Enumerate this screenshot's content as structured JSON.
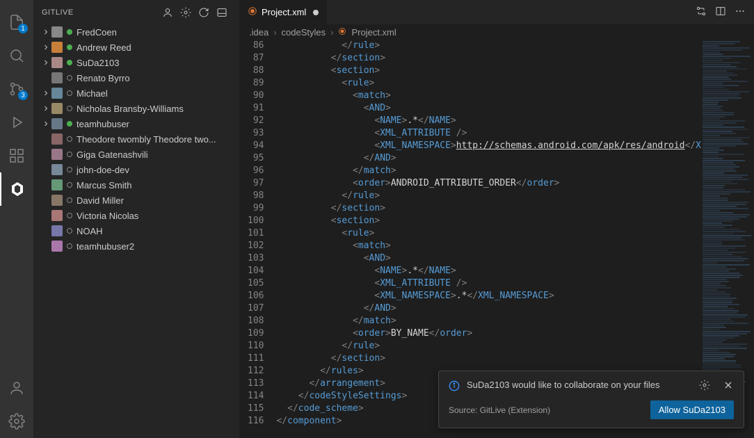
{
  "sidebar": {
    "title": "GITLIVE",
    "users": [
      {
        "name": "FredCoen",
        "status": "online",
        "expandable": true,
        "avatarColor": "#888"
      },
      {
        "name": "Andrew Reed",
        "status": "online",
        "expandable": true,
        "avatarColor": "#c87f3a"
      },
      {
        "name": "SuDa2103",
        "status": "online",
        "expandable": true,
        "avatarColor": "#a88"
      },
      {
        "name": "Renato Byrro",
        "status": "offline",
        "expandable": false,
        "avatarColor": "#777"
      },
      {
        "name": "Michael",
        "status": "offline",
        "expandable": true,
        "avatarColor": "#689"
      },
      {
        "name": "Nicholas Bransby-Williams",
        "status": "offline",
        "expandable": true,
        "avatarColor": "#986"
      },
      {
        "name": "teamhubuser",
        "status": "online",
        "expandable": true,
        "avatarColor": "#678"
      },
      {
        "name": "Theodore twombly Theodore two...",
        "status": "offline",
        "expandable": false,
        "avatarColor": "#866"
      },
      {
        "name": "Giga Gatenashvili",
        "status": "offline",
        "expandable": false,
        "avatarColor": "#978"
      },
      {
        "name": "john-doe-dev",
        "status": "offline",
        "expandable": false,
        "avatarColor": "#789"
      },
      {
        "name": "Marcus Smith",
        "status": "offline",
        "expandable": false,
        "avatarColor": "#697"
      },
      {
        "name": "David Miller",
        "status": "offline",
        "expandable": false,
        "avatarColor": "#876"
      },
      {
        "name": "Victoria Nicolas",
        "status": "offline",
        "expandable": false,
        "avatarColor": "#a77"
      },
      {
        "name": "NOAH",
        "status": "offline",
        "expandable": false,
        "avatarColor": "#77a"
      },
      {
        "name": "teamhubuser2",
        "status": "offline",
        "expandable": false,
        "avatarColor": "#a7a"
      }
    ]
  },
  "activityBadges": {
    "explorer": "1",
    "scm": "3"
  },
  "tab": {
    "label": "Project.xml"
  },
  "breadcrumb": {
    "seg1": ".idea",
    "seg2": "codeStyles",
    "seg3": "Project.xml"
  },
  "code": {
    "startLine": 86,
    "lines": [
      {
        "indent": 6,
        "html": "<span class='t-bracket'>&lt;/</span><span class='t-tag'>rule</span><span class='t-bracket'>&gt;</span>"
      },
      {
        "indent": 5,
        "html": "<span class='t-bracket'>&lt;/</span><span class='t-tag'>section</span><span class='t-bracket'>&gt;</span>"
      },
      {
        "indent": 5,
        "html": "<span class='t-bracket'>&lt;</span><span class='t-tag'>section</span><span class='t-bracket'>&gt;</span>"
      },
      {
        "indent": 6,
        "html": "<span class='t-bracket'>&lt;</span><span class='t-tag'>rule</span><span class='t-bracket'>&gt;</span>"
      },
      {
        "indent": 7,
        "html": "<span class='t-bracket'>&lt;</span><span class='t-tag'>match</span><span class='t-bracket'>&gt;</span>"
      },
      {
        "indent": 8,
        "html": "<span class='t-bracket'>&lt;</span><span class='t-tag'>AND</span><span class='t-bracket'>&gt;</span>"
      },
      {
        "indent": 9,
        "html": "<span class='t-bracket'>&lt;</span><span class='t-tag'>NAME</span><span class='t-bracket'>&gt;</span><span class='t-text'>.*</span><span class='t-bracket'>&lt;/</span><span class='t-tag'>NAME</span><span class='t-bracket'>&gt;</span>"
      },
      {
        "indent": 9,
        "html": "<span class='t-bracket'>&lt;</span><span class='t-tag'>XML_ATTRIBUTE</span><span class='t-bracket'> /&gt;</span>"
      },
      {
        "indent": 9,
        "html": "<span class='t-bracket'>&lt;</span><span class='t-tag'>XML_NAMESPACE</span><span class='t-bracket'>&gt;</span><span class='t-url'>http://schemas.android.com/apk/res/android</span><span class='t-bracket'>&lt;/</span><span class='t-tag'>X</span>"
      },
      {
        "indent": 8,
        "html": "<span class='t-bracket'>&lt;/</span><span class='t-tag'>AND</span><span class='t-bracket'>&gt;</span>"
      },
      {
        "indent": 7,
        "html": "<span class='t-bracket'>&lt;/</span><span class='t-tag'>match</span><span class='t-bracket'>&gt;</span>"
      },
      {
        "indent": 7,
        "html": "<span class='t-bracket'>&lt;</span><span class='t-tag'>order</span><span class='t-bracket'>&gt;</span><span class='t-text'>ANDROID_ATTRIBUTE_ORDER</span><span class='t-bracket'>&lt;/</span><span class='t-tag'>order</span><span class='t-bracket'>&gt;</span>"
      },
      {
        "indent": 6,
        "html": "<span class='t-bracket'>&lt;/</span><span class='t-tag'>rule</span><span class='t-bracket'>&gt;</span>"
      },
      {
        "indent": 5,
        "html": "<span class='t-bracket'>&lt;/</span><span class='t-tag'>section</span><span class='t-bracket'>&gt;</span>"
      },
      {
        "indent": 5,
        "html": "<span class='t-bracket'>&lt;</span><span class='t-tag'>section</span><span class='t-bracket'>&gt;</span>"
      },
      {
        "indent": 6,
        "html": "<span class='t-bracket'>&lt;</span><span class='t-tag'>rule</span><span class='t-bracket'>&gt;</span>"
      },
      {
        "indent": 7,
        "html": "<span class='t-bracket'>&lt;</span><span class='t-tag'>match</span><span class='t-bracket'>&gt;</span>"
      },
      {
        "indent": 8,
        "html": "<span class='t-bracket'>&lt;</span><span class='t-tag'>AND</span><span class='t-bracket'>&gt;</span>"
      },
      {
        "indent": 9,
        "html": "<span class='t-bracket'>&lt;</span><span class='t-tag'>NAME</span><span class='t-bracket'>&gt;</span><span class='t-text'>.*</span><span class='t-bracket'>&lt;/</span><span class='t-tag'>NAME</span><span class='t-bracket'>&gt;</span>"
      },
      {
        "indent": 9,
        "html": "<span class='t-bracket'>&lt;</span><span class='t-tag'>XML_ATTRIBUTE</span><span class='t-bracket'> /&gt;</span>"
      },
      {
        "indent": 9,
        "html": "<span class='t-bracket'>&lt;</span><span class='t-tag'>XML_NAMESPACE</span><span class='t-bracket'>&gt;</span><span class='t-text'>.*</span><span class='t-bracket'>&lt;/</span><span class='t-tag'>XML_NAMESPACE</span><span class='t-bracket'>&gt;</span>"
      },
      {
        "indent": 8,
        "html": "<span class='t-bracket'>&lt;/</span><span class='t-tag'>AND</span><span class='t-bracket'>&gt;</span>"
      },
      {
        "indent": 7,
        "html": "<span class='t-bracket'>&lt;/</span><span class='t-tag'>match</span><span class='t-bracket'>&gt;</span>"
      },
      {
        "indent": 7,
        "html": "<span class='t-bracket'>&lt;</span><span class='t-tag'>order</span><span class='t-bracket'>&gt;</span><span class='t-text'>BY_NAME</span><span class='t-bracket'>&lt;/</span><span class='t-tag'>order</span><span class='t-bracket'>&gt;</span>"
      },
      {
        "indent": 6,
        "html": "<span class='t-bracket'>&lt;/</span><span class='t-tag'>rule</span><span class='t-bracket'>&gt;</span>"
      },
      {
        "indent": 5,
        "html": "<span class='t-bracket'>&lt;/</span><span class='t-tag'>section</span><span class='t-bracket'>&gt;</span>"
      },
      {
        "indent": 4,
        "html": "<span class='t-bracket'>&lt;/</span><span class='t-tag'>rules</span><span class='t-bracket'>&gt;</span>"
      },
      {
        "indent": 3,
        "html": "<span class='t-bracket'>&lt;/</span><span class='t-tag'>arrangement</span><span class='t-bracket'>&gt;</span>"
      },
      {
        "indent": 2,
        "html": "<span class='t-bracket'>&lt;/</span><span class='t-tag'>codeStyleSettings</span><span class='t-bracket'>&gt;</span>"
      },
      {
        "indent": 1,
        "html": "<span class='t-bracket'>&lt;/</span><span class='t-tag'>code_scheme</span><span class='t-bracket'>&gt;</span>"
      },
      {
        "indent": 0,
        "html": "<span class='t-bracket'>&lt;/</span><span class='t-tag'>component</span><span class='t-bracket'>&gt;</span>"
      }
    ]
  },
  "notification": {
    "message": "SuDa2103 would like to collaborate on your files",
    "source": "Source: GitLive (Extension)",
    "button": "Allow SuDa2103"
  }
}
